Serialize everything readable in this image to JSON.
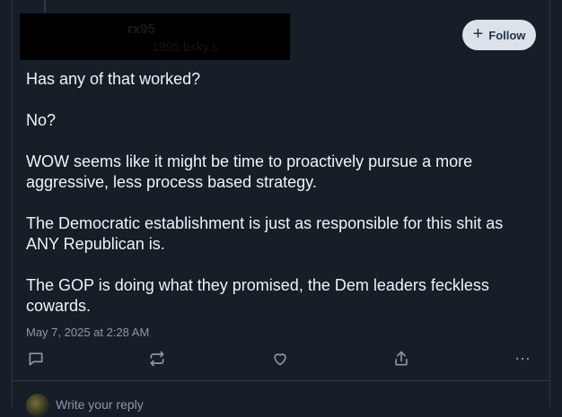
{
  "post": {
    "author_name": "rx95",
    "author_handle": "1995.bsky.s",
    "follow_label": "Follow",
    "paragraphs": [
      "Has any of that worked?",
      "No?",
      "WOW seems like it might be time to proactively pursue a more aggressive, less process based strategy.",
      "The Democratic establishment is just as responsible for this shit as ANY Republican is.",
      "The GOP is doing what they promised, the Dem leaders feckless cowards."
    ],
    "timestamp": "May 7, 2025 at 2:28 AM"
  },
  "actions": [
    "reply-icon",
    "repost-icon",
    "like-icon",
    "share-icon",
    "more-icon"
  ],
  "reply": {
    "placeholder": "Write your reply"
  },
  "colors": {
    "background": "#161e27",
    "follow_bg": "#dce2ea",
    "muted": "#8b98a8"
  }
}
